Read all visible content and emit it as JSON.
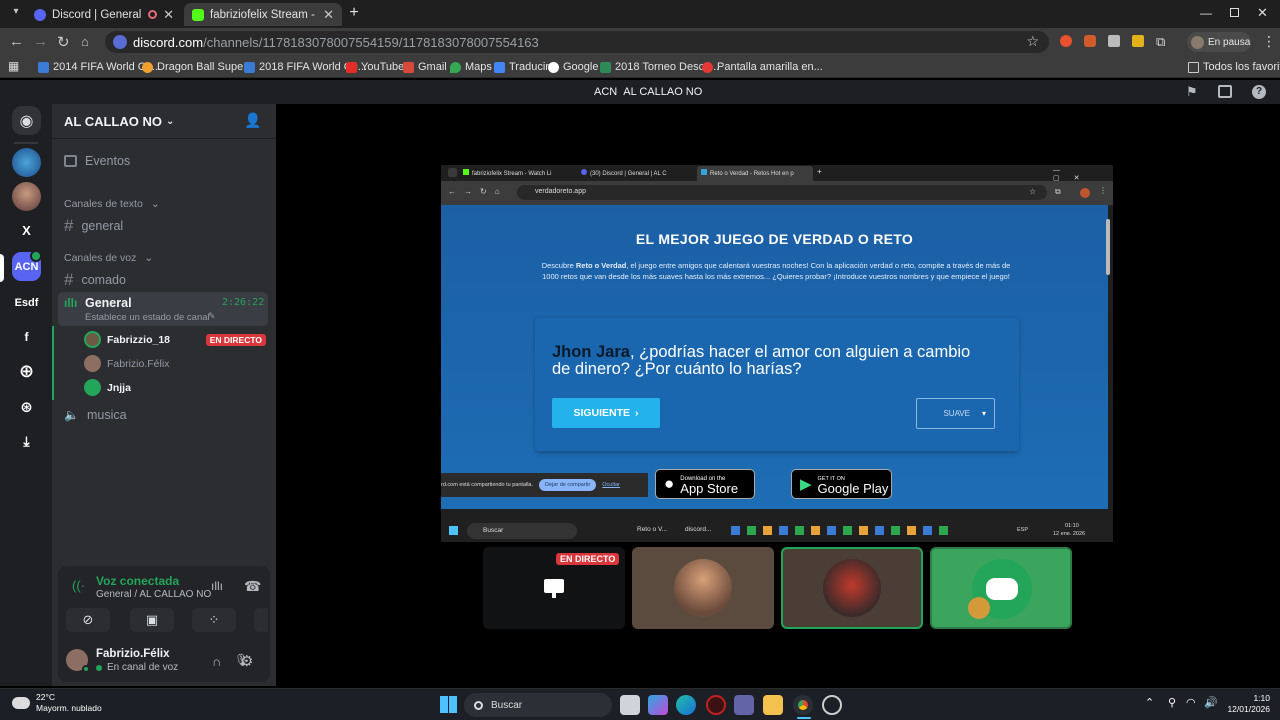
{
  "browser": {
    "tabs": [
      {
        "label": "Discord | General | AL CALL",
        "active": false
      },
      {
        "label": "fabriziofelix Stream - Watch Liv",
        "active": true
      }
    ],
    "url_domain": "discord.com",
    "url_path": "/channels/1178183078007554159/1178183078007554163",
    "profile_label": "En pausa",
    "bookmarks": [
      "2014 FIFA World Cu...",
      "Dragon Ball Super...",
      "2018 FIFA World Cu...",
      "YouTube",
      "Gmail",
      "Maps",
      "Traducir",
      "Google",
      "2018 Torneo Desce...",
      "Pantalla amarilla en..."
    ],
    "all_bookmarks": "Todos los favoritos"
  },
  "discord": {
    "top_title_tag": "ACN",
    "top_title": "AL CALLAO NO",
    "servers": [
      "X",
      "ACN",
      "Esdf",
      "f"
    ],
    "server_name": "AL CALLAO NO",
    "events": "Eventos",
    "text_category": "Canales de texto",
    "text_channels": [
      "general"
    ],
    "voice_category": "Canales de voz",
    "channel_comado": "comado",
    "voice_channel": {
      "name": "General",
      "timer": "2:26:22",
      "status": "Establece un estado de canal"
    },
    "voice_users": [
      {
        "name": "Fabrizzio_18",
        "live": "EN DIRECTO"
      },
      {
        "name": "Fabrizio.Félix",
        "live": ""
      },
      {
        "name": "Jnjja",
        "live": ""
      }
    ],
    "channel_musica": "musica",
    "voice_panel": {
      "status": "Voz conectada",
      "location": "General / AL CALLAO NO"
    },
    "user": {
      "name": "Fabrizio.Félix",
      "status": "En canal de voz"
    },
    "tile_live": "EN DIRECTO"
  },
  "shared_screen": {
    "tabs": [
      "fabriziofelix Stream - Watch Li",
      "(30) Discord | General | AL C",
      "Reto o Verdad - Retos Hot en p"
    ],
    "url": "verdadoreto.app",
    "heading": "EL MEJOR JUEGO DE VERDAD O RETO",
    "intro_pre": "Descubre ",
    "intro_bold": "Reto o Verdad",
    "intro_post": ", el juego entre amigos que calentará vuestras noches! Con la aplicación verdad o reto, compite a través de más de 1000 retos que van desde los más suaves hasta los más extremos... ¿Quieres probar? ¡Introduce vuestros nombres y que empiece el juego!",
    "player": "Jhon Jara",
    "question": ", ¿podrías hacer el amor con alguien a cambio de dinero? ¿Por cuánto lo harías?",
    "next_button": "SIGUIENTE",
    "level_select": "SUAVE",
    "share_notice": "rd.com está compartiendo tu pantalla.",
    "stop_share": "Dejar de compartir",
    "hide": "Ocultar",
    "appstore_small": "Download on the",
    "appstore_big": "App Store",
    "gplay_small": "GET IT ON",
    "gplay_big": "Google Play",
    "taskbar_search": "Buscar",
    "taskbar_app1": "Reto o V...",
    "taskbar_app2": "discord...",
    "taskbar_lang": "ESP",
    "taskbar_time": "01:10",
    "taskbar_date": "12 ene. 2026"
  },
  "windows": {
    "weather_temp": "22°C",
    "weather_desc": "Mayorm. nublado",
    "search": "Buscar",
    "time": "1:10",
    "date": "12/01/2026"
  },
  "colors": {
    "discord_blurple": "#5865f2",
    "live_red": "#da373c",
    "voice_green": "#23a55a",
    "site_blue": "#1d6db5"
  }
}
